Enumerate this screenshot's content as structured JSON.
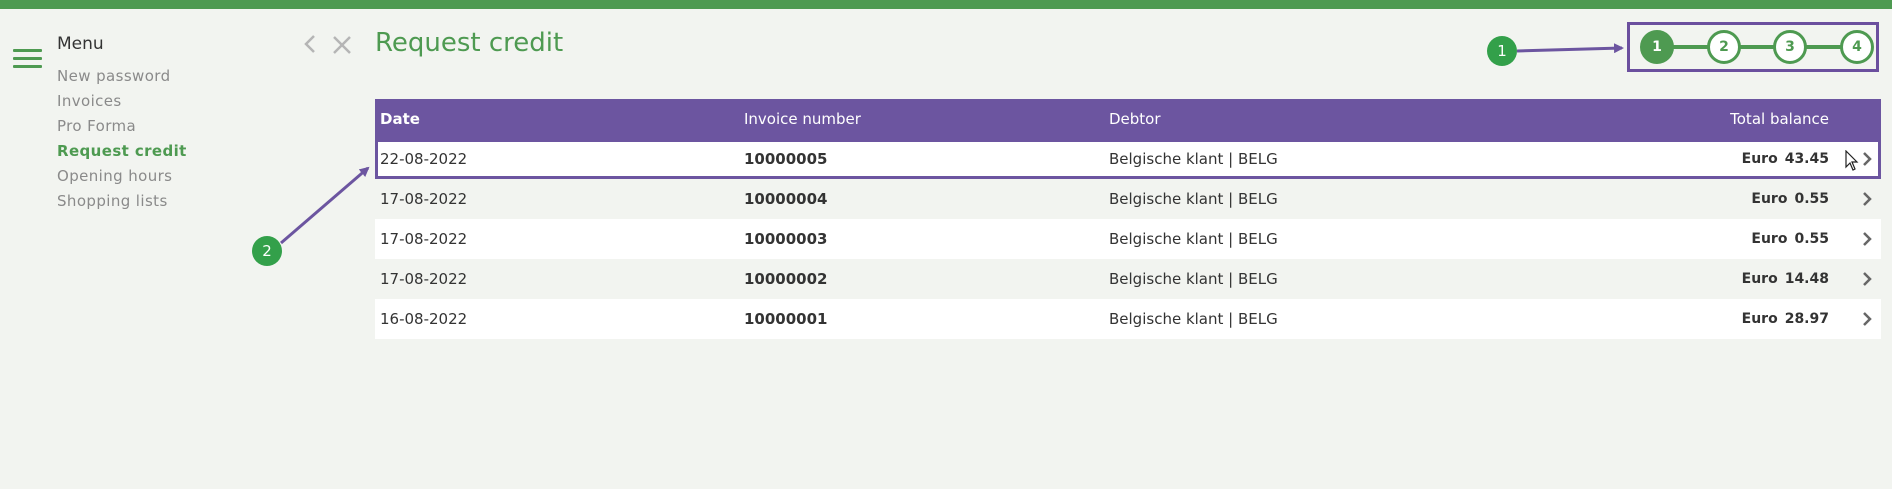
{
  "menu": {
    "title": "Menu",
    "items": [
      {
        "label": "New password"
      },
      {
        "label": "Invoices"
      },
      {
        "label": "Pro Forma"
      },
      {
        "label": "Request credit",
        "active": true
      },
      {
        "label": "Opening hours"
      },
      {
        "label": "Shopping lists"
      }
    ]
  },
  "page": {
    "title": "Request credit"
  },
  "stepper": {
    "steps": [
      "1",
      "2",
      "3",
      "4"
    ],
    "current": "1"
  },
  "table": {
    "headers": {
      "date": "Date",
      "invoice": "Invoice number",
      "debtor": "Debtor",
      "balance": "Total balance"
    },
    "rows": [
      {
        "date": "22-08-2022",
        "invoice": "10000005",
        "debtor": "Belgische klant | BELG",
        "currency": "Euro",
        "amount": "43.45"
      },
      {
        "date": "17-08-2022",
        "invoice": "10000004",
        "debtor": "Belgische klant | BELG",
        "currency": "Euro",
        "amount": "0.55"
      },
      {
        "date": "17-08-2022",
        "invoice": "10000003",
        "debtor": "Belgische klant | BELG",
        "currency": "Euro",
        "amount": "0.55"
      },
      {
        "date": "17-08-2022",
        "invoice": "10000002",
        "debtor": "Belgische klant | BELG",
        "currency": "Euro",
        "amount": "14.48"
      },
      {
        "date": "16-08-2022",
        "invoice": "10000001",
        "debtor": "Belgische klant | BELG",
        "currency": "Euro",
        "amount": "28.97"
      }
    ]
  },
  "annotations": {
    "badge1": "1",
    "badge2": "2"
  },
  "colors": {
    "brand_green": "#4e9a51",
    "header_purple": "#6c55a0",
    "annotation_green": "#33a04a"
  },
  "icons": [
    "hamburger-icon",
    "chevron-left-icon",
    "close-icon",
    "chevron-right-icon",
    "mouse-cursor-icon"
  ]
}
